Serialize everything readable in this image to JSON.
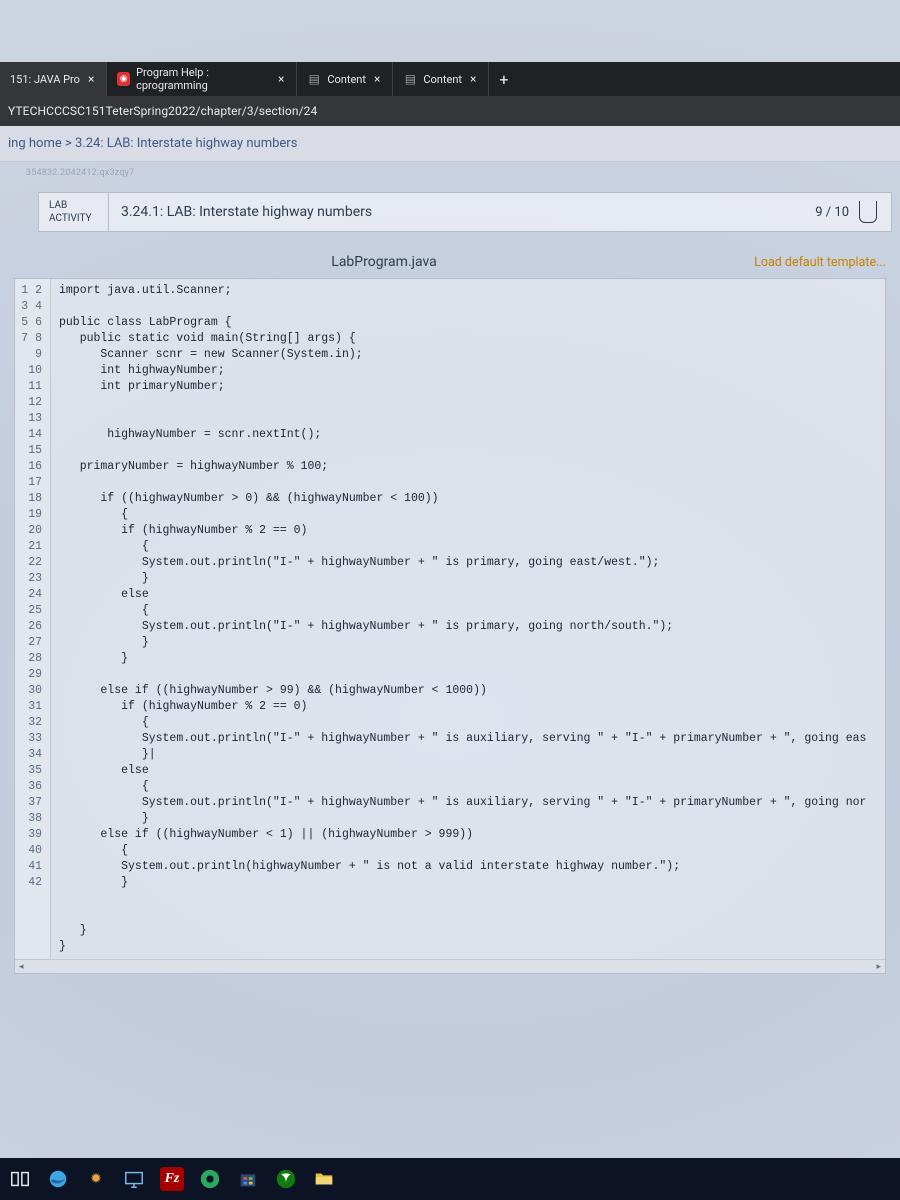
{
  "tabs": [
    {
      "label": "151: JAVA Pro",
      "favicon": ""
    },
    {
      "label": "Program Help : cprogramming",
      "favicon": "red"
    },
    {
      "label": "Content",
      "favicon": "check"
    },
    {
      "label": "Content",
      "favicon": "check"
    }
  ],
  "url": "YTECHCCCSC151TeterSpring2022/chapter/3/section/24",
  "breadcrumb": "ing home > 3.24: LAB: Interstate highway numbers",
  "question_id": "354832.2042412.qx3zqy7",
  "activity": {
    "tag1": "LAB",
    "tag2": "ACTIVITY",
    "title": "3.24.1: LAB: Interstate highway numbers",
    "score": "9 / 10"
  },
  "file_tab": "LabProgram.java",
  "load_template": "Load default template...",
  "code_lines": [
    "import java.util.Scanner;",
    "",
    "public class LabProgram {",
    "   public static void main(String[] args) {",
    "      Scanner scnr = new Scanner(System.in);",
    "      int highwayNumber;",
    "      int primaryNumber;",
    "",
    "",
    "       highwayNumber = scnr.nextInt();",
    "",
    "   primaryNumber = highwayNumber % 100;",
    "",
    "      if ((highwayNumber > 0) && (highwayNumber < 100))",
    "         {",
    "         if (highwayNumber % 2 == 0)",
    "            {",
    "            System.out.println(\"I-\" + highwayNumber + \" is primary, going east/west.\");",
    "            }",
    "         else",
    "            {",
    "            System.out.println(\"I-\" + highwayNumber + \" is primary, going north/south.\");",
    "            }",
    "         }",
    "",
    "      else if ((highwayNumber > 99) && (highwayNumber < 1000))",
    "         if (highwayNumber % 2 == 0)",
    "            {",
    "            System.out.println(\"I-\" + highwayNumber + \" is auxiliary, serving \" + \"I-\" + primaryNumber + \", going eas",
    "            }|",
    "         else",
    "            {",
    "            System.out.println(\"I-\" + highwayNumber + \" is auxiliary, serving \" + \"I-\" + primaryNumber + \", going nor",
    "            }",
    "      else if ((highwayNumber < 1) || (highwayNumber > 999))",
    "         {",
    "         System.out.println(highwayNumber + \" is not a valid interstate highway number.\");",
    "         }",
    "",
    "",
    "   }",
    "}"
  ],
  "scroll_left": "◂",
  "scroll_right": "▸"
}
